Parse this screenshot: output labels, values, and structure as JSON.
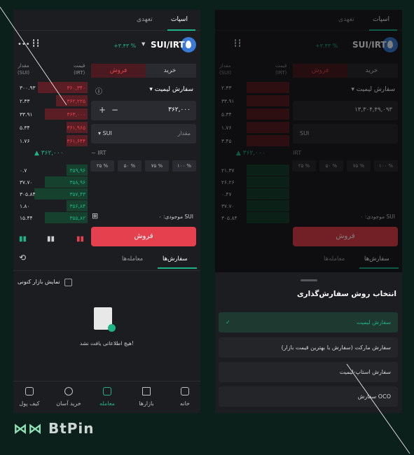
{
  "left": {
    "tabs": {
      "spot": "اسپات",
      "margin": "تعهدی"
    },
    "pair": "SUI/IRT",
    "change": "+۳.۴۳ %",
    "ob_head": {
      "amount": "مقدار",
      "amount_unit": "(SUI)",
      "price": "قیمت",
      "price_unit": "(IRT)"
    },
    "asks": [
      {
        "amount": "۳۰۰.۹۳",
        "price": "۳۶۰,۳۴۰",
        "fill": 0.7
      },
      {
        "amount": "۲.۳۳",
        "price": "۳۶۲,۲۲۵",
        "fill": 0.45
      },
      {
        "amount": "۳۳.۹۱",
        "price": "۳۶۳,۰۰۰",
        "fill": 0.6
      },
      {
        "amount": "۵.۳۴",
        "price": "۳۶۱,۹۶۵",
        "fill": 0.3
      },
      {
        "amount": "۱.۷۶",
        "price": "۳۶۱,۶۴۴",
        "fill": 0.3
      }
    ],
    "mid_price": "۳۶۲,۰۰۰",
    "bids": [
      {
        "amount": "۰.۷",
        "price": "۳۵۹,۹۶",
        "fill": 0.3
      },
      {
        "amount": "۳۷.۷۰",
        "price": "۳۵۸,۹۶",
        "fill": 0.6
      },
      {
        "amount": "۳۰۵.۸۴",
        "price": "۳۵۷,۴۳",
        "fill": 0.75
      },
      {
        "amount": "۱.۸۰",
        "price": "۳۵۶,۸۴",
        "fill": 0.3
      },
      {
        "amount": "۱۵.۴۴",
        "price": "۳۵۵,۸۲",
        "fill": 0.6
      }
    ],
    "buy": "خرید",
    "sell": "فروش",
    "order_type": "سفارش لیمیت",
    "price_value": "۳۶۲,۰۰۰",
    "amount_placeholder": "مقدار",
    "amount_unit": "SUI",
    "price_unit": "IRT",
    "pcts": [
      "۲۵ %",
      "۵۰ %",
      "۷۵ %",
      "۱۰۰ %"
    ],
    "balance": "موجودی: ۰ SUI",
    "sell_btn": "فروش",
    "orders_tab": "سفارش‌ها",
    "trades_tab": "معامله‌ها",
    "show_market": "نمایش بازار کنونی",
    "empty": "هیچ اطلاعاتی یافت نشد!",
    "nav": [
      "خانه",
      "بازارها",
      "معامله",
      "خرید آسان",
      "کیف پول"
    ]
  },
  "right": {
    "tabs": {
      "spot": "اسپات",
      "margin": "تعهدی"
    },
    "pair": "SUI/IRT",
    "change": "+۳.۴۳ %",
    "ob_head": {
      "amount": "مقدار",
      "amount_unit": "(SUI)",
      "price": "قیمت",
      "price_unit": "(IRT)"
    },
    "asks": [
      "۲.۳۳",
      "۳۳.۹۱",
      "۵.۳۴",
      "۱.۷۶",
      "۳.۴۵"
    ],
    "mid_price": "۳۶۲,۰۰۰",
    "bids": [
      "۲۱.۳۷",
      "۲۶.۲۶",
      "۰.۴۷",
      "۳۷.۷۰",
      "۳۰۵.۸۴"
    ],
    "buy": "خرید",
    "sell": "فروش",
    "order_type": "سفارش لیمیت",
    "price_value": "۱۳,۳۰۴,۴۹,۰۹۳",
    "amount_unit": "SUI",
    "price_unit": "IRT",
    "pcts": [
      "۲۵ %",
      "۵۰ %",
      "۷۵ %",
      "۱۰۰ %"
    ],
    "balance": "موجودی: ۰ SUI",
    "sell_btn": "فروش",
    "orders_tab": "سفارش‌ها",
    "trades_tab": "معامله‌ها",
    "sheet_title": "انتخاب روش سفارش‌گذاری",
    "options": [
      "سفارش لیمیت",
      "سفارش مارکت (سفارش با بهترین قیمت بازار)",
      "سفارش استاپ-لیمیت",
      "سفارش OCO"
    ]
  },
  "brand": {
    "logo": "BtPin"
  }
}
